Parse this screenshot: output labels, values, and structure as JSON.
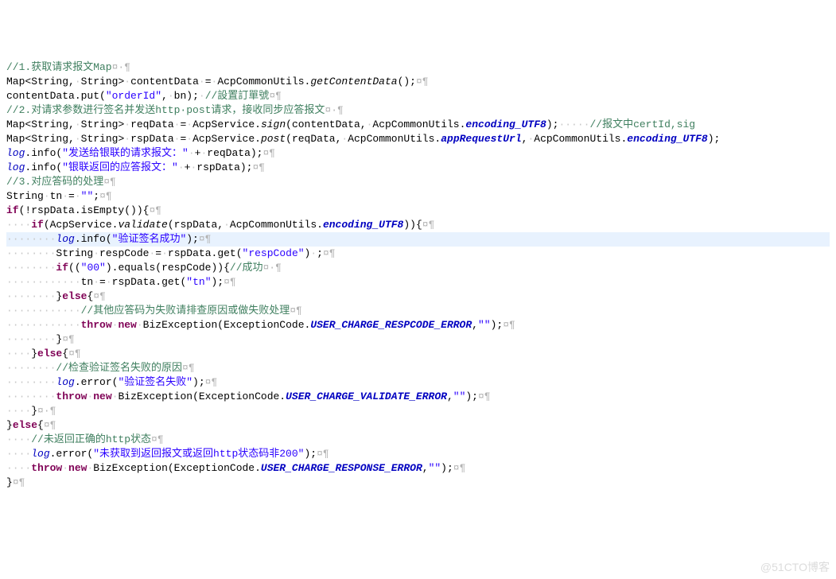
{
  "watermark": "@51CTO博客",
  "lines": [
    {
      "cls": "",
      "tokens": [
        {
          "t": "//1.获取请求报文Map",
          "c": "c-comment"
        },
        {
          "t": "¤·¶",
          "c": "eol"
        }
      ]
    },
    {
      "cls": "",
      "tokens": [
        {
          "t": "Map<String,",
          "c": "c-type"
        },
        {
          "t": "·",
          "c": "ws-dot"
        },
        {
          "t": "String>",
          "c": "c-type"
        },
        {
          "t": "·",
          "c": "ws-dot"
        },
        {
          "t": "contentData",
          "c": ""
        },
        {
          "t": "·",
          "c": "ws-dot"
        },
        {
          "t": "=",
          "c": ""
        },
        {
          "t": "·",
          "c": "ws-dot"
        },
        {
          "t": "AcpCommonUtils.",
          "c": ""
        },
        {
          "t": "getContentData",
          "c": "c-method-ital"
        },
        {
          "t": "();",
          "c": ""
        },
        {
          "t": "¤¶",
          "c": "eol"
        }
      ]
    },
    {
      "cls": "",
      "tokens": [
        {
          "t": "contentData.put(",
          "c": ""
        },
        {
          "t": "\"orderId\"",
          "c": "c-string"
        },
        {
          "t": ",",
          "c": ""
        },
        {
          "t": "·",
          "c": "ws-dot"
        },
        {
          "t": "bn);",
          "c": ""
        },
        {
          "t": "·",
          "c": "ws-dot"
        },
        {
          "t": "//設置訂單號",
          "c": "c-comment"
        },
        {
          "t": "¤¶",
          "c": "eol"
        }
      ]
    },
    {
      "cls": "",
      "tokens": [
        {
          "t": "//2.对请求参数进行签名并发送http·post请求，接收同步应答报文",
          "c": "c-comment"
        },
        {
          "t": "¤·¶",
          "c": "eol"
        }
      ]
    },
    {
      "cls": "",
      "tokens": [
        {
          "t": "Map<String,",
          "c": "c-type"
        },
        {
          "t": "·",
          "c": "ws-dot"
        },
        {
          "t": "String>",
          "c": "c-type"
        },
        {
          "t": "·",
          "c": "ws-dot"
        },
        {
          "t": "reqData",
          "c": ""
        },
        {
          "t": "·",
          "c": "ws-dot"
        },
        {
          "t": "=",
          "c": ""
        },
        {
          "t": "·",
          "c": "ws-dot"
        },
        {
          "t": "AcpService.",
          "c": ""
        },
        {
          "t": "sign",
          "c": "c-method-ital"
        },
        {
          "t": "(contentData,",
          "c": ""
        },
        {
          "t": "·",
          "c": "ws-dot"
        },
        {
          "t": "AcpCommonUtils.",
          "c": ""
        },
        {
          "t": "encoding_UTF8",
          "c": "c-static"
        },
        {
          "t": ");",
          "c": ""
        },
        {
          "t": "·····",
          "c": "ws-dot"
        },
        {
          "t": "//报文中certId,sig",
          "c": "c-comment"
        }
      ]
    },
    {
      "cls": "",
      "tokens": [
        {
          "t": "Map<String,",
          "c": "c-type"
        },
        {
          "t": "·",
          "c": "ws-dot"
        },
        {
          "t": "String>",
          "c": "c-type"
        },
        {
          "t": "·",
          "c": "ws-dot"
        },
        {
          "t": "rspData",
          "c": ""
        },
        {
          "t": "·",
          "c": "ws-dot"
        },
        {
          "t": "=",
          "c": ""
        },
        {
          "t": "·",
          "c": "ws-dot"
        },
        {
          "t": "AcpService.",
          "c": ""
        },
        {
          "t": "post",
          "c": "c-method-ital"
        },
        {
          "t": "(reqData,",
          "c": ""
        },
        {
          "t": "·",
          "c": "ws-dot"
        },
        {
          "t": "AcpCommonUtils.",
          "c": ""
        },
        {
          "t": "appRequestUrl",
          "c": "c-static"
        },
        {
          "t": ",",
          "c": ""
        },
        {
          "t": "·",
          "c": "ws-dot"
        },
        {
          "t": "AcpCommonUtils.",
          "c": ""
        },
        {
          "t": "encoding_UTF8",
          "c": "c-static"
        },
        {
          "t": ");",
          "c": ""
        }
      ]
    },
    {
      "cls": "",
      "tokens": [
        {
          "t": "log",
          "c": "c-field"
        },
        {
          "t": ".info(",
          "c": ""
        },
        {
          "t": "\"发送给银联的请求报文：\"",
          "c": "c-string"
        },
        {
          "t": "·",
          "c": "ws-dot"
        },
        {
          "t": "+",
          "c": ""
        },
        {
          "t": "·",
          "c": "ws-dot"
        },
        {
          "t": "reqData);",
          "c": ""
        },
        {
          "t": "¤¶",
          "c": "eol"
        }
      ]
    },
    {
      "cls": "",
      "tokens": [
        {
          "t": "log",
          "c": "c-field"
        },
        {
          "t": ".info(",
          "c": ""
        },
        {
          "t": "\"银联返回的应答报文：\"",
          "c": "c-string"
        },
        {
          "t": "·",
          "c": "ws-dot"
        },
        {
          "t": "+",
          "c": ""
        },
        {
          "t": "·",
          "c": "ws-dot"
        },
        {
          "t": "rspData);",
          "c": ""
        },
        {
          "t": "¤¶",
          "c": "eol"
        }
      ]
    },
    {
      "cls": "",
      "tokens": [
        {
          "t": "//3.对应答码的处理",
          "c": "c-comment"
        },
        {
          "t": "¤¶",
          "c": "eol"
        }
      ]
    },
    {
      "cls": "",
      "tokens": [
        {
          "t": "String",
          "c": "c-type"
        },
        {
          "t": "·",
          "c": "ws-dot"
        },
        {
          "t": "tn",
          "c": ""
        },
        {
          "t": "·",
          "c": "ws-dot"
        },
        {
          "t": "=",
          "c": ""
        },
        {
          "t": "·",
          "c": "ws-dot"
        },
        {
          "t": "\"\"",
          "c": "c-string"
        },
        {
          "t": ";",
          "c": ""
        },
        {
          "t": "¤¶",
          "c": "eol"
        }
      ]
    },
    {
      "cls": "",
      "tokens": [
        {
          "t": "if",
          "c": "c-keyword"
        },
        {
          "t": "(!rspData.isEmpty()){",
          "c": ""
        },
        {
          "t": "¤¶",
          "c": "eol"
        }
      ]
    },
    {
      "cls": "",
      "tokens": [
        {
          "t": "····",
          "c": "ws-dot"
        },
        {
          "t": "if",
          "c": "c-keyword"
        },
        {
          "t": "(AcpService.",
          "c": ""
        },
        {
          "t": "validate",
          "c": "c-method-ital"
        },
        {
          "t": "(rspData,",
          "c": ""
        },
        {
          "t": "·",
          "c": "ws-dot"
        },
        {
          "t": "AcpCommonUtils.",
          "c": ""
        },
        {
          "t": "encoding_UTF8",
          "c": "c-static"
        },
        {
          "t": ")){",
          "c": ""
        },
        {
          "t": "¤¶",
          "c": "eol"
        }
      ]
    },
    {
      "cls": "hl",
      "tokens": [
        {
          "t": "········",
          "c": "ws-dot"
        },
        {
          "t": "log",
          "c": "c-field"
        },
        {
          "t": ".info(",
          "c": ""
        },
        {
          "t": "\"验证签名成功\"",
          "c": "c-string"
        },
        {
          "t": ");",
          "c": ""
        },
        {
          "t": "¤¶",
          "c": "eol"
        }
      ]
    },
    {
      "cls": "",
      "tokens": [
        {
          "t": "········",
          "c": "ws-dot"
        },
        {
          "t": "String",
          "c": "c-type"
        },
        {
          "t": "·",
          "c": "ws-dot"
        },
        {
          "t": "respCode",
          "c": ""
        },
        {
          "t": "·",
          "c": "ws-dot"
        },
        {
          "t": "=",
          "c": ""
        },
        {
          "t": "·",
          "c": "ws-dot"
        },
        {
          "t": "rspData.get(",
          "c": ""
        },
        {
          "t": "\"respCode\"",
          "c": "c-string"
        },
        {
          "t": ")",
          "c": ""
        },
        {
          "t": "·",
          "c": "ws-dot"
        },
        {
          "t": ";",
          "c": ""
        },
        {
          "t": "¤¶",
          "c": "eol"
        }
      ]
    },
    {
      "cls": "",
      "tokens": [
        {
          "t": "········",
          "c": "ws-dot"
        },
        {
          "t": "if",
          "c": "c-keyword"
        },
        {
          "t": "((",
          "c": ""
        },
        {
          "t": "\"00\"",
          "c": "c-string"
        },
        {
          "t": ").equals(respCode)){",
          "c": ""
        },
        {
          "t": "//成功",
          "c": "c-comment"
        },
        {
          "t": "¤·¶",
          "c": "eol"
        }
      ]
    },
    {
      "cls": "",
      "tokens": [
        {
          "t": "············",
          "c": "ws-dot"
        },
        {
          "t": "tn",
          "c": ""
        },
        {
          "t": "·",
          "c": "ws-dot"
        },
        {
          "t": "=",
          "c": ""
        },
        {
          "t": "·",
          "c": "ws-dot"
        },
        {
          "t": "rspData.get(",
          "c": ""
        },
        {
          "t": "\"tn\"",
          "c": "c-string"
        },
        {
          "t": ");",
          "c": ""
        },
        {
          "t": "¤¶",
          "c": "eol"
        }
      ]
    },
    {
      "cls": "",
      "tokens": [
        {
          "t": "········",
          "c": "ws-dot"
        },
        {
          "t": "}",
          "c": ""
        },
        {
          "t": "else",
          "c": "c-keyword"
        },
        {
          "t": "{",
          "c": ""
        },
        {
          "t": "¤¶",
          "c": "eol"
        }
      ]
    },
    {
      "cls": "",
      "tokens": [
        {
          "t": "············",
          "c": "ws-dot"
        },
        {
          "t": "//其他应答码为失败请排查原因或做失败处理",
          "c": "c-comment"
        },
        {
          "t": "¤¶",
          "c": "eol"
        }
      ]
    },
    {
      "cls": "",
      "tokens": [
        {
          "t": "············",
          "c": "ws-dot"
        },
        {
          "t": "throw",
          "c": "c-keyword"
        },
        {
          "t": "·",
          "c": "ws-dot"
        },
        {
          "t": "new",
          "c": "c-keyword"
        },
        {
          "t": "·",
          "c": "ws-dot"
        },
        {
          "t": "BizException(ExceptionCode.",
          "c": ""
        },
        {
          "t": "USER_CHARGE_RESPCODE_ERROR",
          "c": "c-static"
        },
        {
          "t": ",",
          "c": ""
        },
        {
          "t": "\"\"",
          "c": "c-string"
        },
        {
          "t": ");",
          "c": ""
        },
        {
          "t": "¤¶",
          "c": "eol"
        }
      ]
    },
    {
      "cls": "",
      "tokens": [
        {
          "t": "········",
          "c": "ws-dot"
        },
        {
          "t": "}",
          "c": ""
        },
        {
          "t": "¤¶",
          "c": "eol"
        }
      ]
    },
    {
      "cls": "",
      "tokens": [
        {
          "t": "····",
          "c": "ws-dot"
        },
        {
          "t": "}",
          "c": ""
        },
        {
          "t": "else",
          "c": "c-keyword"
        },
        {
          "t": "{",
          "c": ""
        },
        {
          "t": "¤¶",
          "c": "eol"
        }
      ]
    },
    {
      "cls": "",
      "tokens": [
        {
          "t": "········",
          "c": "ws-dot"
        },
        {
          "t": "//检查验证签名失败的原因",
          "c": "c-comment"
        },
        {
          "t": "¤¶",
          "c": "eol"
        }
      ]
    },
    {
      "cls": "",
      "tokens": [
        {
          "t": "········",
          "c": "ws-dot"
        },
        {
          "t": "log",
          "c": "c-field"
        },
        {
          "t": ".error(",
          "c": ""
        },
        {
          "t": "\"验证签名失败\"",
          "c": "c-string"
        },
        {
          "t": ");",
          "c": ""
        },
        {
          "t": "¤¶",
          "c": "eol"
        }
      ]
    },
    {
      "cls": "",
      "tokens": [
        {
          "t": "········",
          "c": "ws-dot"
        },
        {
          "t": "throw",
          "c": "c-keyword"
        },
        {
          "t": "·",
          "c": "ws-dot"
        },
        {
          "t": "new",
          "c": "c-keyword"
        },
        {
          "t": "·",
          "c": "ws-dot"
        },
        {
          "t": "BizException(ExceptionCode.",
          "c": ""
        },
        {
          "t": "USER_CHARGE_VALIDATE_ERROR",
          "c": "c-static"
        },
        {
          "t": ",",
          "c": ""
        },
        {
          "t": "\"\"",
          "c": "c-string"
        },
        {
          "t": ");",
          "c": ""
        },
        {
          "t": "¤¶",
          "c": "eol"
        }
      ]
    },
    {
      "cls": "",
      "tokens": [
        {
          "t": "····",
          "c": "ws-dot"
        },
        {
          "t": "}",
          "c": ""
        },
        {
          "t": "¤·¶",
          "c": "eol"
        }
      ]
    },
    {
      "cls": "",
      "tokens": [
        {
          "t": "}",
          "c": ""
        },
        {
          "t": "else",
          "c": "c-keyword"
        },
        {
          "t": "{",
          "c": ""
        },
        {
          "t": "¤¶",
          "c": "eol"
        }
      ]
    },
    {
      "cls": "",
      "tokens": [
        {
          "t": "····",
          "c": "ws-dot"
        },
        {
          "t": "//未返回正确的http状态",
          "c": "c-comment"
        },
        {
          "t": "¤¶",
          "c": "eol"
        }
      ]
    },
    {
      "cls": "",
      "tokens": [
        {
          "t": "····",
          "c": "ws-dot"
        },
        {
          "t": "log",
          "c": "c-field"
        },
        {
          "t": ".error(",
          "c": ""
        },
        {
          "t": "\"未获取到返回报文或返回http状态码非200\"",
          "c": "c-string"
        },
        {
          "t": ");",
          "c": ""
        },
        {
          "t": "¤¶",
          "c": "eol"
        }
      ]
    },
    {
      "cls": "",
      "tokens": [
        {
          "t": "····",
          "c": "ws-dot"
        },
        {
          "t": "throw",
          "c": "c-keyword"
        },
        {
          "t": "·",
          "c": "ws-dot"
        },
        {
          "t": "new",
          "c": "c-keyword"
        },
        {
          "t": "·",
          "c": "ws-dot"
        },
        {
          "t": "BizException(ExceptionCode.",
          "c": ""
        },
        {
          "t": "USER_CHARGE_RESPONSE_ERROR",
          "c": "c-static"
        },
        {
          "t": ",",
          "c": ""
        },
        {
          "t": "\"\"",
          "c": "c-string"
        },
        {
          "t": ");",
          "c": ""
        },
        {
          "t": "¤¶",
          "c": "eol"
        }
      ]
    },
    {
      "cls": "",
      "tokens": [
        {
          "t": "}",
          "c": ""
        },
        {
          "t": "¤¶",
          "c": "eol"
        }
      ]
    }
  ]
}
